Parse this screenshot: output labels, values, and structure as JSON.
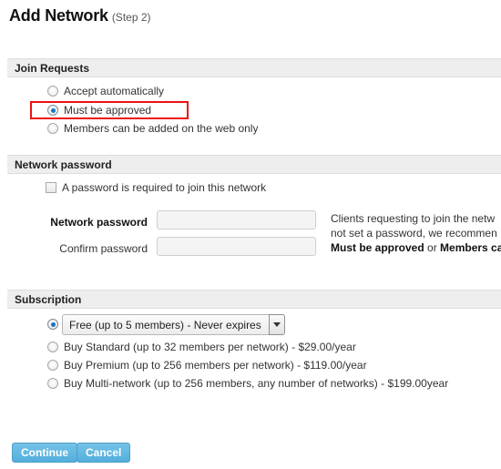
{
  "header": {
    "title": "Add Network",
    "step": "(Step 2)"
  },
  "sections": {
    "join_requests": {
      "title": "Join Requests",
      "options": [
        {
          "label": "Accept automatically",
          "selected": false
        },
        {
          "label": "Must be approved",
          "selected": true
        },
        {
          "label": "Members can be added on the web only",
          "selected": false
        }
      ]
    },
    "network_password": {
      "title": "Network password",
      "checkbox_label": "A password is required to join this network",
      "checkbox_checked": false,
      "fields": [
        {
          "label": "Network password",
          "value": "",
          "placeholder": ""
        },
        {
          "label": "Confirm password",
          "value": "",
          "placeholder": ""
        }
      ],
      "help_lines": [
        {
          "text": "Clients requesting to join the netw",
          "bold": false
        },
        {
          "text": "not set a password, we recommen",
          "bold": false
        }
      ],
      "help_line3": {
        "bold_a": "Must be approved",
        "plain": " or ",
        "bold_b": "Members ca"
      }
    },
    "subscription": {
      "title": "Subscription",
      "free_option": {
        "selected": true,
        "select_value": "Free (up to 5 members) - Never expires"
      },
      "options": [
        {
          "label": "Buy Standard (up to 32 members per network) - $29.00/year",
          "selected": false
        },
        {
          "label": "Buy Premium (up to 256 members per network) - $119.00/year",
          "selected": false
        },
        {
          "label": "Buy Multi-network (up to 256 members, any number of networks) - $199.00year",
          "selected": false
        }
      ]
    }
  },
  "footer": {
    "continue_label": "Continue",
    "cancel_label": "Cancel"
  },
  "colors": {
    "accent_blue": "#53aedd",
    "highlight_red": "#ee1111",
    "section_bar": "#eeeeee",
    "radio_dot": "#1a74c4"
  }
}
